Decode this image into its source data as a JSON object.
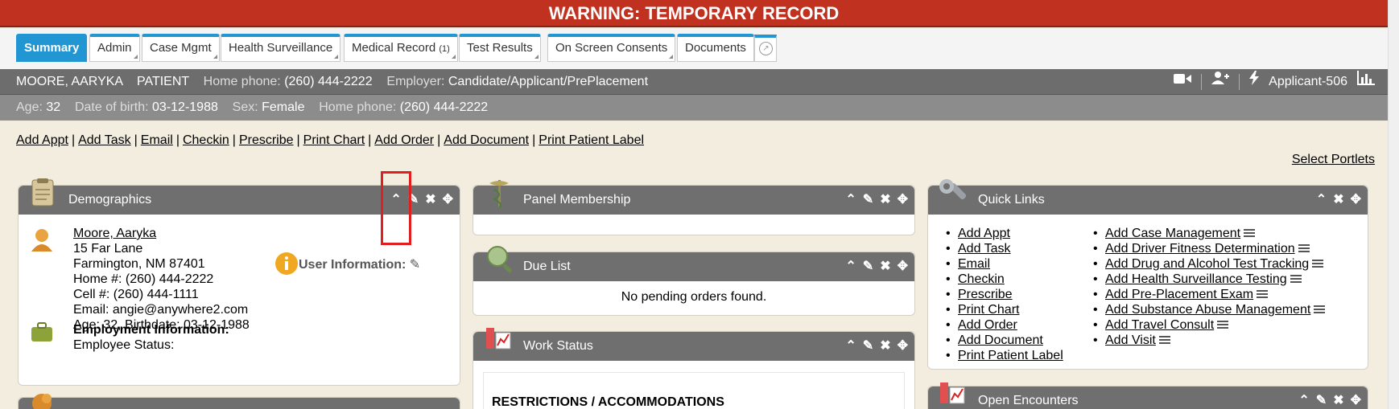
{
  "warning": "WARNING: TEMPORARY RECORD",
  "tabs": [
    {
      "label": "Summary",
      "count": ""
    },
    {
      "label": "Admin",
      "count": ""
    },
    {
      "label": "Case Mgmt",
      "count": ""
    },
    {
      "label": "Health Surveillance",
      "count": ""
    },
    {
      "label": "Medical Record",
      "count": "(1)"
    },
    {
      "label": "Test Results",
      "count": ""
    },
    {
      "label": "On Screen Consents",
      "count": ""
    },
    {
      "label": "Documents",
      "count": ""
    }
  ],
  "patient": {
    "name": "MOORE, AARYKA",
    "type": "PATIENT",
    "home_phone_label": "Home phone:",
    "home_phone": "(260) 444-2222",
    "employer_label": "Employer:",
    "employer": "Candidate/Applicant/PrePlacement",
    "applicant_id": "Applicant-506",
    "age_label": "Age:",
    "age": "32",
    "dob_label": "Date of birth:",
    "dob": "03-12-1988",
    "sex_label": "Sex:",
    "sex": "Female"
  },
  "actions": [
    "Add Appt",
    "Add Task",
    "Email",
    "Checkin",
    "Prescribe",
    "Print Chart",
    "Add Order",
    "Add Document",
    "Print Patient Label"
  ],
  "select_portlets": "Select Portlets",
  "demographics": {
    "title": "Demographics",
    "name_link": "Moore, Aaryka",
    "address1": "15 Far Lane",
    "address2": "Farmington, NM 87401",
    "home": "Home #: (260) 444-2222",
    "cell": "Cell #: (260) 444-1111",
    "email": "Email: angie@anywhere2.com",
    "age_birth": "Age: 32, Birthdate: 03-12-1988",
    "user_info": "User Information:",
    "employment_heading": "Employment Information:",
    "employee_status": "Employee Status:"
  },
  "panel_membership": {
    "title": "Panel Membership"
  },
  "due_list": {
    "title": "Due List",
    "empty": "No pending orders found."
  },
  "work_status": {
    "title": "Work Status",
    "restrictions": "RESTRICTIONS / ACCOMMODATIONS"
  },
  "quick_links": {
    "title": "Quick Links",
    "col1": [
      "Add Appt",
      "Add Task",
      "Email",
      "Checkin",
      "Prescribe",
      "Print Chart",
      "Add Order",
      "Add Document",
      "Print Patient Label"
    ],
    "col2": [
      "Add Case Management",
      "Add Driver Fitness Determination",
      "Add Drug and Alcohol Test Tracking",
      "Add Health Surveillance Testing",
      "Add Pre-Placement Exam",
      "Add Substance Abuse Management",
      "Add Travel Consult",
      "Add Visit"
    ]
  },
  "open_encounters": {
    "title": "Open Encounters"
  },
  "icons": {
    "video": "video-camera-icon",
    "add_user": "add-user-icon",
    "bolt": "lightning-icon",
    "chart": "bar-chart-icon",
    "collapse": "chevron-up-icon",
    "edit": "pencil-icon",
    "close": "close-icon",
    "move": "move-icon",
    "info": "info-icon"
  },
  "colors": {
    "warning_bg": "#c0321f",
    "tab_accent": "#2196d3",
    "header_dark": "#6d6d6d",
    "header_light": "#8c8c8c",
    "page_bg": "#f3ede0"
  }
}
